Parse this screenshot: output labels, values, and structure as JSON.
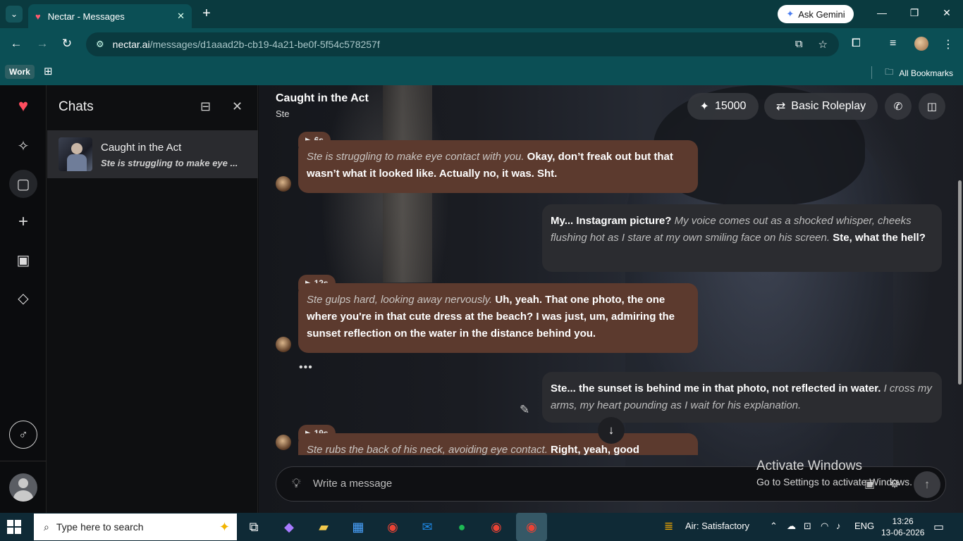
{
  "browser": {
    "tab_title": "Nectar - Messages",
    "ask_gemini": "Ask Gemini",
    "url_host": "nectar.ai",
    "url_path": "/messages/d1aaad2b-cb19-4a21-be0f-5f54c578257f",
    "bookmarks": {
      "work": "Work",
      "all_bookmarks": "All Bookmarks"
    }
  },
  "sidebar": {
    "title": "Chats",
    "chats": [
      {
        "title": "Caught in the Act",
        "preview": "Ste is struggling to make eye ..."
      }
    ]
  },
  "chat": {
    "title": "Caught in the Act",
    "character": "Ste",
    "credits": "15000",
    "mode": "Basic Roleplay",
    "messages": [
      {
        "role": "ai",
        "duration": "6s",
        "italic": "Ste is struggling to make eye contact with you.",
        "text": " Okay, don’t freak out but that wasn’t what it looked like. Actually no, it was. Sht."
      },
      {
        "role": "user",
        "a": "My... Instagram picture? ",
        "italic": "My voice comes out as a shocked whisper, cheeks flushing hot as I stare at my own smiling face on his screen.",
        "b": " Ste, what the hell?"
      },
      {
        "role": "ai",
        "duration": "12s",
        "italic": "Ste gulps hard, looking away nervously.",
        "text": " Uh, yeah. That one photo, the one where you're in that cute dress at the beach? I was just, um, admiring the sunset reflection on the water in the distance behind you."
      },
      {
        "role": "user",
        "a": "Ste... the sunset is behind me in that photo, not reflected in water. ",
        "italic": "I cross my arms, my heart pounding as I wait for his explanation.",
        "b": ""
      },
      {
        "role": "ai",
        "duration": "19s",
        "italic": "Ste rubs the back of his neck, avoiding eye contact.",
        "text": " Right, yeah, good"
      }
    ],
    "typing_dots": "•••",
    "composer_placeholder": "Write a message"
  },
  "watermark": {
    "line1": "Activate Windows",
    "line2": "Go to Settings to activate Windows."
  },
  "taskbar": {
    "search_placeholder": "Type here to search",
    "weather": "Air: Satisfactory",
    "lang": "ENG",
    "time": "13:26",
    "date": "13-06-2026"
  },
  "colors": {
    "ai_bubble": "#5c3a2e",
    "user_bubble": "#2b2c30",
    "browser": "#0b4f55",
    "brand": "#ff4d5e"
  }
}
